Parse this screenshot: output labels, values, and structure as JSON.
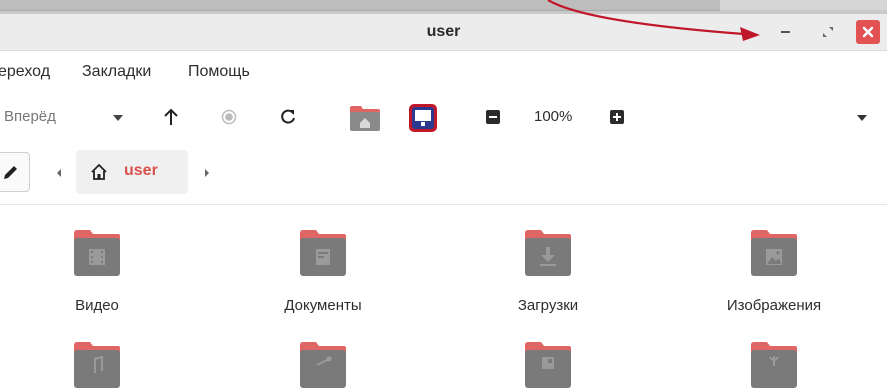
{
  "window": {
    "title": "user"
  },
  "menubar": {
    "items": [
      "ереход",
      "Закладки",
      "Помощь"
    ]
  },
  "toolbar": {
    "forward_label": "Вперёд",
    "zoom_level": "100%"
  },
  "pathbar": {
    "crumb_label": "user"
  },
  "files": [
    {
      "label": "Видео",
      "icon": "film-icon"
    },
    {
      "label": "Документы",
      "icon": "document-icon"
    },
    {
      "label": "Загрузки",
      "icon": "download-icon"
    },
    {
      "label": "Изображения",
      "icon": "image-icon"
    },
    {
      "label": "",
      "icon": "music-icon"
    },
    {
      "label": "",
      "icon": "share-icon"
    },
    {
      "label": "",
      "icon": "template-icon"
    },
    {
      "label": "",
      "icon": "public-icon"
    }
  ],
  "colors": {
    "annotation_arrow": "#c0182a",
    "folder_tab": "#e06666",
    "folder_body": "#7a7a7a",
    "accent": "#d9534f",
    "close_button": "#e25252"
  }
}
